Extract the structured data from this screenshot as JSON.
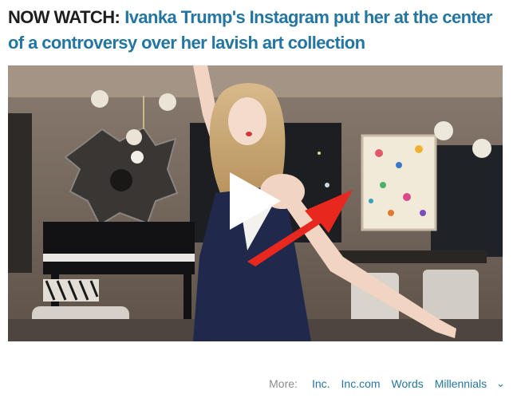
{
  "headline": {
    "label": "NOW WATCH:",
    "title": "Ivanka Trump's Instagram put her at the center of a controversy over her lavish art collection"
  },
  "video": {
    "play_icon": "play-icon",
    "annotation_icon": "red-arrow-icon"
  },
  "more_bar": {
    "label": "More:",
    "links": [
      "Inc.",
      "Inc.com",
      "Words",
      "Millennials"
    ],
    "expand_icon": "chevron-down-icon"
  },
  "colors": {
    "link": "#2476a0",
    "label": "#1e1e1e",
    "muted": "#8b8b8b",
    "arrow": "#e8281e"
  }
}
